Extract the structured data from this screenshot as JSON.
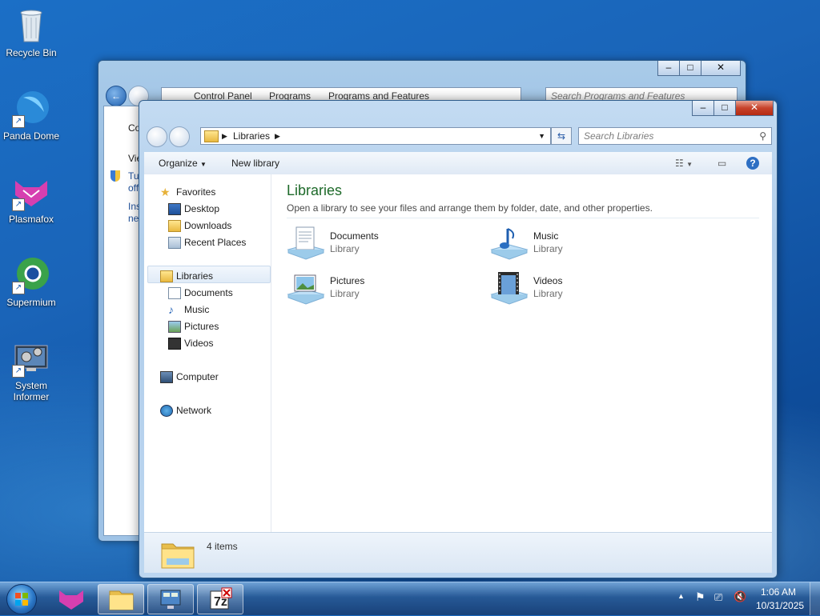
{
  "desktop": {
    "icons": [
      {
        "label": "Recycle Bin"
      },
      {
        "label": "Panda Dome"
      },
      {
        "label": "Plasmafox"
      },
      {
        "label": "Supermium"
      },
      {
        "label": "System Informer"
      }
    ]
  },
  "back_window": {
    "breadcrumb": [
      "Control Panel",
      "Programs",
      "Programs and Features"
    ],
    "search_placeholder": "Search Programs and Features",
    "partial_text": [
      "Co",
      "Vie",
      "Tu",
      "off",
      "Ins",
      "ne"
    ]
  },
  "front_window": {
    "breadcrumb": [
      "Libraries"
    ],
    "search_placeholder": "Search Libraries",
    "toolbar": {
      "organize": "Organize",
      "new_library": "New library"
    },
    "nav": {
      "favorites": "Favorites",
      "desktop": "Desktop",
      "downloads": "Downloads",
      "recent_places": "Recent Places",
      "libraries": "Libraries",
      "documents": "Documents",
      "music": "Music",
      "pictures": "Pictures",
      "videos": "Videos",
      "computer": "Computer",
      "network": "Network"
    },
    "heading": "Libraries",
    "subheading": "Open a library to see your files and arrange them by folder, date, and other properties.",
    "libraries": [
      {
        "name": "Documents",
        "type": "Library"
      },
      {
        "name": "Music",
        "type": "Library"
      },
      {
        "name": "Pictures",
        "type": "Library"
      },
      {
        "name": "Videos",
        "type": "Library"
      }
    ],
    "status": "4 items"
  },
  "taskbar": {
    "time": "1:06 AM",
    "date": "10/31/2025"
  }
}
